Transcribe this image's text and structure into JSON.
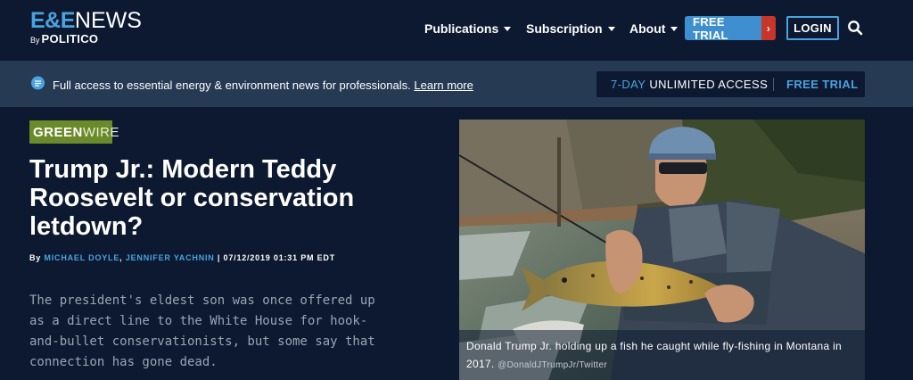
{
  "logo": {
    "ee": "E&E",
    "news": "NEWS",
    "by": "By",
    "politico": "POLITICO"
  },
  "nav": [
    {
      "label": "Publications"
    },
    {
      "label": "Subscription"
    },
    {
      "label": "About"
    }
  ],
  "header": {
    "free_trial": "FREE TRIAL",
    "free_trial_arrow": "›",
    "login": "LOGIN"
  },
  "banner": {
    "text": "Full access to essential energy & environment news for professionals.",
    "link": "Learn more",
    "access_days": "7-DAY",
    "access_rest": "UNLIMITED ACCESS",
    "access_cta": "FREE TRIAL"
  },
  "article": {
    "section_green": "GREEN",
    "section_wire": "WIRE",
    "headline": "Trump Jr.: Modern Teddy Roosevelt or conservation letdown?",
    "by": "By",
    "author1": "MICHAEL DOYLE",
    "author2": "JENNIFER YACHNIN",
    "dateline": "| 07/12/2019 01:31 PM EDT",
    "dek": "The president's eldest son was once offered up as a direct line to the White House for hook-and-bullet conservationists, but some say that connection has gone dead."
  },
  "photo": {
    "caption": "Donald Trump Jr. holding up a fish he caught while fly-fishing in Montana in 2017.",
    "credit": "@DonaldJTrumpJr/Twitter"
  },
  "colors": {
    "background": "#0c1930",
    "banner": "#263a54",
    "accent": "#4aa3e0",
    "section": "#6b8a2a",
    "arrow": "#c8352a"
  }
}
